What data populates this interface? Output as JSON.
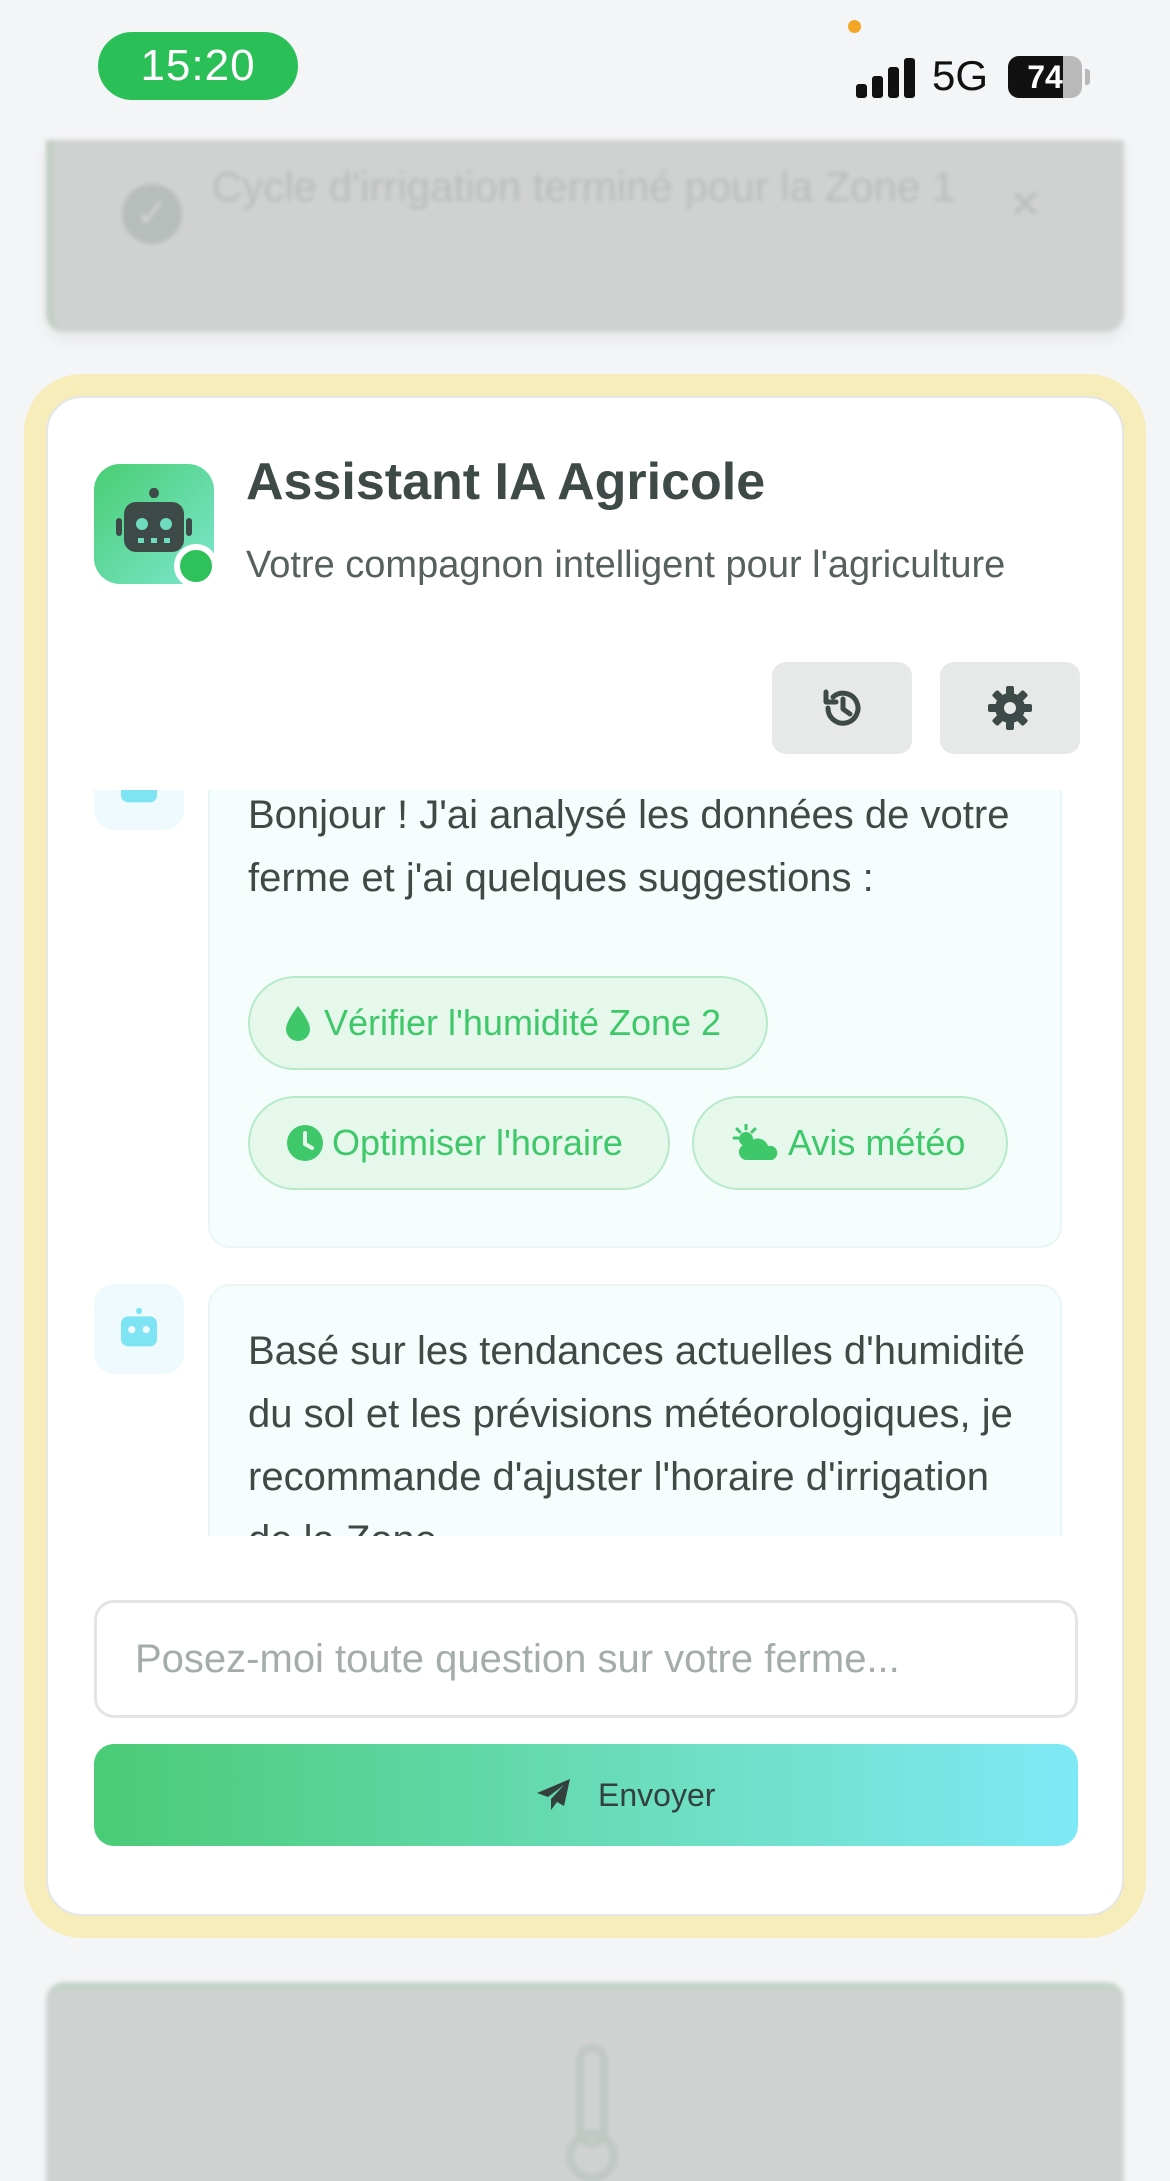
{
  "status_bar": {
    "time": "15:20",
    "network": "5G",
    "battery_level": "74",
    "icons": [
      "signal-icon",
      "battery-icon"
    ]
  },
  "background_notification": {
    "text": "Cycle d'irrigation terminé pour la Zone 1",
    "icons": [
      "check-circle-icon",
      "close-icon"
    ]
  },
  "assistant": {
    "title": "Assistant IA Agricole",
    "subtitle": "Votre compagnon intelligent pour l'agriculture",
    "status": "online",
    "toolbar_icons": [
      "history-icon",
      "gear-icon"
    ]
  },
  "messages": [
    {
      "sender": "bot",
      "text": "Bonjour ! J'ai analysé les données de votre ferme et j'ai quelques suggestions :",
      "suggestions": [
        {
          "label": "Vérifier l'humidité Zone 2",
          "icon": "droplet-icon"
        },
        {
          "label": "Optimiser l'horaire",
          "icon": "clock-icon"
        },
        {
          "label": "Avis météo",
          "icon": "cloud-sun-icon"
        }
      ]
    },
    {
      "sender": "bot",
      "text": "Basé sur les tendances actuelles d'humidité du sol et les prévisions météorologiques, je recommande d'ajuster l'horaire d'irrigation de la Zone"
    }
  ],
  "composer": {
    "placeholder": "Posez-moi toute question sur votre ferme...",
    "value": "",
    "send_label": "Envoyer",
    "send_icon": "paper-plane-icon"
  },
  "colors": {
    "accent_green": "#2fc15a",
    "highlight_yellow": "#f7edbb",
    "gradient_end_cyan": "#7ee9f6"
  }
}
